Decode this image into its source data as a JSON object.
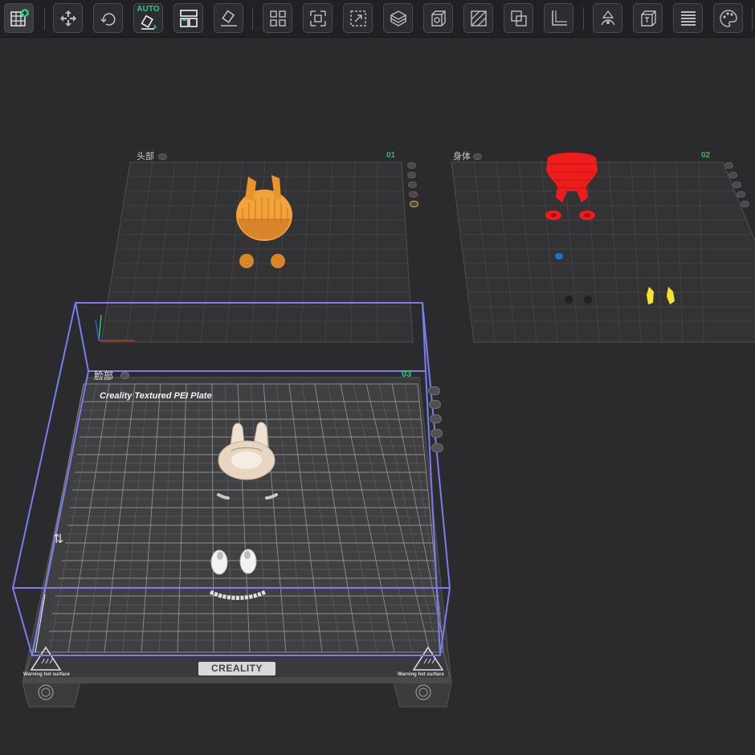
{
  "toolbar": {
    "auto_label": "AUTO",
    "buttons": [
      {
        "id": "add-plate",
        "icon": "grid-plus-icon"
      },
      {
        "id": "arrange",
        "icon": "move-arrows-icon"
      },
      {
        "id": "orient",
        "icon": "rotate-icon"
      },
      {
        "id": "auto-orient",
        "icon": "auto-orient-icon"
      },
      {
        "id": "layout",
        "icon": "layout-icon"
      },
      {
        "id": "lay-on-face",
        "icon": "lay-flat-icon"
      },
      {
        "id": "split-objects",
        "icon": "split-objects-icon"
      },
      {
        "id": "split-parts",
        "icon": "split-parts-icon"
      },
      {
        "id": "scale",
        "icon": "scale-icon"
      },
      {
        "id": "cut",
        "icon": "cut-icon"
      },
      {
        "id": "hollow",
        "icon": "hollow-icon"
      },
      {
        "id": "support-paint",
        "icon": "support-paint-icon"
      },
      {
        "id": "boolean",
        "icon": "boolean-icon"
      },
      {
        "id": "measure",
        "icon": "measure-icon"
      },
      {
        "id": "seam-paint",
        "icon": "seam-paint-icon"
      },
      {
        "id": "text-emboss",
        "icon": "emboss-icon"
      },
      {
        "id": "variable-layer",
        "icon": "variable-layer-icon"
      },
      {
        "id": "color-paint",
        "icon": "color-paint-icon"
      }
    ]
  },
  "plates": [
    {
      "label": "头部",
      "number": "01"
    },
    {
      "label": "身体",
      "number": "02"
    },
    {
      "label": "脸部",
      "number": "03",
      "plate_type": "Creality Textured PEI Plate",
      "brand": "CREALITY",
      "warning": "Warning hot surface"
    }
  ],
  "colors": {
    "background": "#2b2b2e",
    "toolbar": "#212124",
    "selection_box": "#7a7cf0",
    "plate_number": "#2fd06a",
    "head_model": "#f2a33a",
    "body_model": "#ee1c1c",
    "face_model": "#e8d6c2"
  }
}
